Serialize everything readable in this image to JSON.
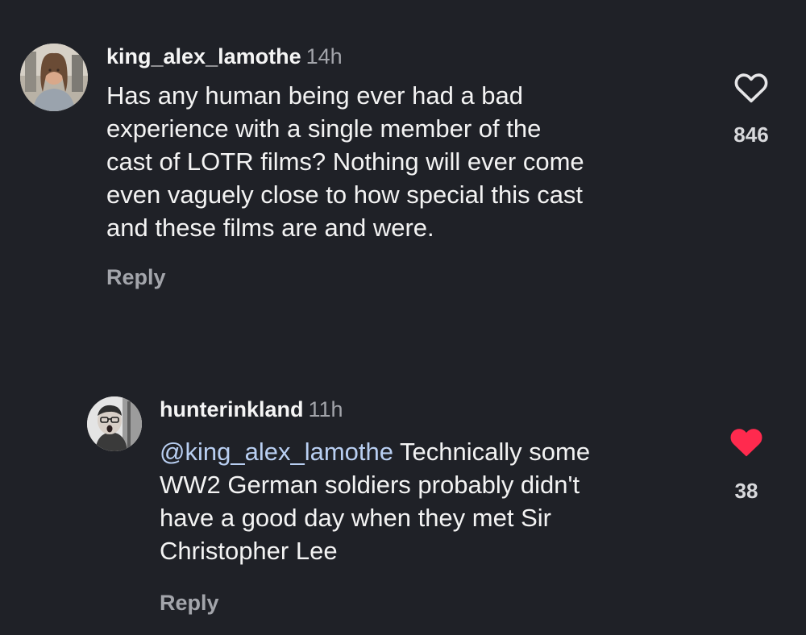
{
  "comments": [
    {
      "username": "king_alex_lamothe",
      "time": "14h",
      "lines": [
        "Has any human being ever had a bad",
        "experience with a single member of the",
        "cast of LOTR films? Nothing will ever come",
        "even vaguely close to how special this cast",
        "and these films are and were."
      ],
      "reply_label": "Reply",
      "like_count": "846",
      "liked": false,
      "like_icon": "heart-outline-icon"
    },
    {
      "username": "hunterinkland",
      "time": "11h",
      "mention": "@king_alex_lamothe",
      "lines": [
        "Technically some",
        "WW2 German soldiers probably didn't",
        "have a good day when they met Sir",
        "Christopher Lee"
      ],
      "reply_label": "Reply",
      "like_count": "38",
      "liked": true,
      "like_icon": "heart-filled-icon",
      "like_color": "#ff2a4e"
    }
  ]
}
